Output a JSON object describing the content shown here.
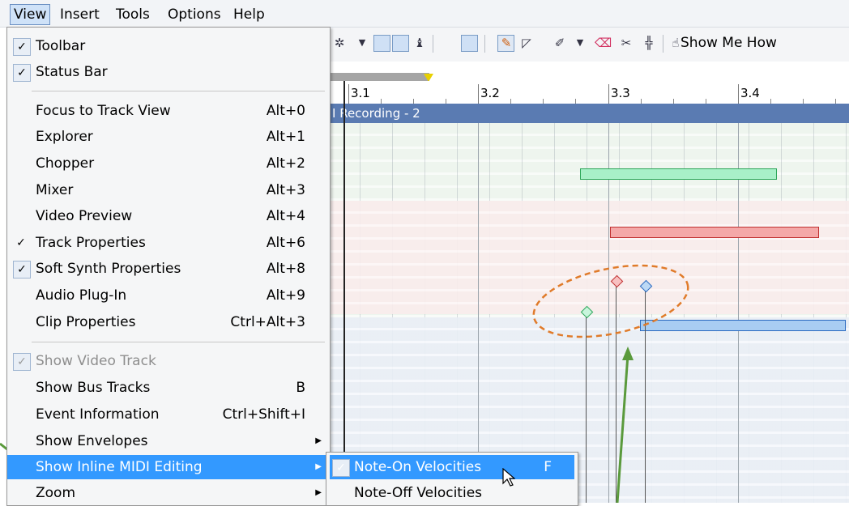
{
  "menubar": {
    "items": [
      "View",
      "Insert",
      "Tools",
      "Options",
      "Help"
    ],
    "selected": "View"
  },
  "toolbar": {
    "show_me_how": "Show Me How"
  },
  "timeline": {
    "ticks": [
      "3.1",
      "3.2",
      "3.3",
      "3.4"
    ],
    "clip_name": "I Recording - 2"
  },
  "view_menu": {
    "items": [
      {
        "label": "Toolbar",
        "checked": true
      },
      {
        "label": "Status Bar",
        "checked": true
      },
      {
        "label": "Focus to Track View",
        "shortcut": "Alt+0"
      },
      {
        "label": "Explorer",
        "shortcut": "Alt+1"
      },
      {
        "label": "Chopper",
        "shortcut": "Alt+2"
      },
      {
        "label": "Mixer",
        "shortcut": "Alt+3"
      },
      {
        "label": "Video Preview",
        "shortcut": "Alt+4"
      },
      {
        "label": "Track Properties",
        "shortcut": "Alt+6",
        "checked": true
      },
      {
        "label": "Soft Synth Properties",
        "shortcut": "Alt+8",
        "checked": true
      },
      {
        "label": "Audio Plug-In",
        "shortcut": "Alt+9"
      },
      {
        "label": "Clip Properties",
        "shortcut": "Ctrl+Alt+3"
      },
      {
        "label": "Show Video Track",
        "checked": true,
        "disabled": true
      },
      {
        "label": "Show Bus Tracks",
        "shortcut": "B"
      },
      {
        "label": "Event Information",
        "shortcut": "Ctrl+Shift+I"
      },
      {
        "label": "Show Envelopes",
        "submenu": true
      },
      {
        "label": "Show Inline MIDI Editing",
        "submenu": true,
        "highlighted": true
      },
      {
        "label": "Zoom",
        "submenu": true
      }
    ]
  },
  "sub_menu": {
    "items": [
      {
        "label": "Note-On Velocities",
        "shortcut": "F",
        "checked": true,
        "highlighted": true
      },
      {
        "label": "Note-Off Velocities"
      }
    ]
  },
  "colors": {
    "highlight": "#3399ff",
    "annotation_arrow": "#5a9a3c",
    "annotation_ellipse": "#e07b2a",
    "note_green": "#a8f0c8",
    "note_red": "#f4a8a8",
    "note_blue": "#a9cdf2"
  }
}
